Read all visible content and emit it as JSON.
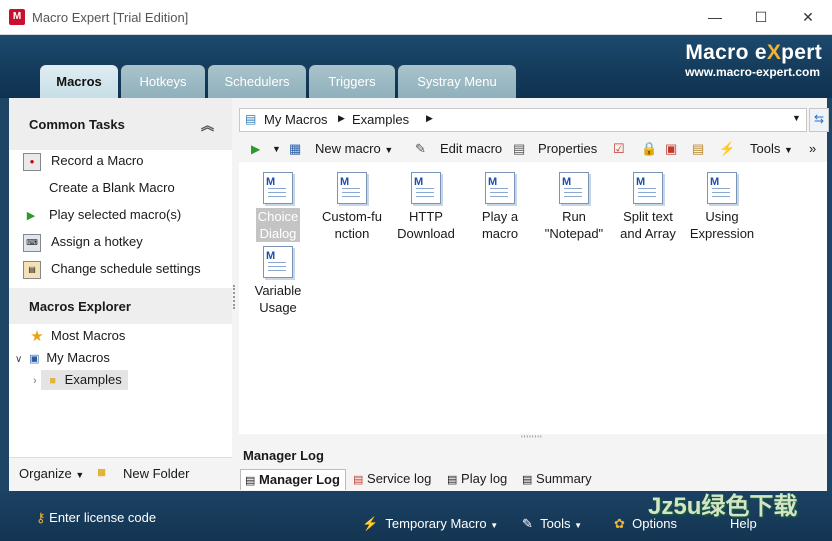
{
  "window": {
    "title": "Macro Expert [Trial Edition]",
    "app_icon_letter": "M",
    "minimize": "—",
    "maximize": "☐",
    "close": "✕"
  },
  "brand": {
    "name_part1": "Macro e",
    "name_x": "X",
    "name_part2": "pert",
    "url": "www.macro-expert.com"
  },
  "tabs": [
    "Macros",
    "Hotkeys",
    "Schedulers",
    "Triggers",
    "Systray Menu"
  ],
  "common_tasks": {
    "title": "Common Tasks",
    "items": [
      {
        "label": "Record a Macro",
        "icon": "record-icon"
      },
      {
        "label": "Create a Blank Macro",
        "icon": ""
      },
      {
        "label": "Play selected macro(s)",
        "icon": "play-icon"
      },
      {
        "label": "Assign a hotkey",
        "icon": "keyboard-icon"
      },
      {
        "label": "Change schedule settings",
        "icon": "schedule-icon"
      }
    ]
  },
  "explorer": {
    "title": "Macros Explorer",
    "items": [
      {
        "label": "Most Macros",
        "icon": "star-icon"
      },
      {
        "label": "My Macros",
        "icon": "computer-icon"
      },
      {
        "label": "Examples",
        "icon": "folder-icon"
      }
    ]
  },
  "left_footer": {
    "organize": "Organize",
    "new_folder": "New Folder"
  },
  "address": {
    "root": "My Macros",
    "child": "Examples"
  },
  "toolbar": {
    "new_macro": "New macro",
    "edit_macro": "Edit macro",
    "properties": "Properties",
    "tools": "Tools",
    "more": "»"
  },
  "macros": [
    [
      "Choice",
      "Dialog"
    ],
    [
      "Custom-fu",
      "nction"
    ],
    [
      "HTTP",
      "Download"
    ],
    [
      "Play a",
      "macro"
    ],
    [
      "Run",
      "\"Notepad\""
    ],
    [
      "Split text",
      "and Array"
    ],
    [
      "Using",
      "Expression"
    ],
    [
      "Variable",
      "Usage"
    ]
  ],
  "manager_log": {
    "title": "Manager Log",
    "tabs": [
      "Manager Log",
      "Service log",
      "Play log",
      "Summary"
    ]
  },
  "footer": {
    "license": "Enter license code",
    "temporary_macro": "Temporary Macro",
    "tools": "Tools",
    "options": "Options",
    "help": "Help",
    "watermark": "Jz5u绿色下载"
  }
}
